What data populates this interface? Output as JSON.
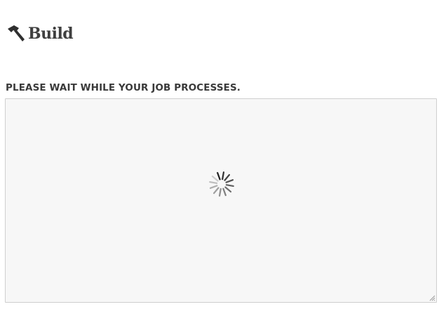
{
  "header": {
    "brand_icon": "hammer-icon",
    "title": "Build"
  },
  "main": {
    "status_heading": "PLEASE WAIT WHILE YOUR JOB PROCESSES.",
    "output_panel": {
      "state": "loading",
      "spinner_icon": "loading-spinner-icon",
      "resize_icon": "resize-grip-icon"
    }
  },
  "colors": {
    "text": "#3a3a3a",
    "panel_background": "#f7f7f7",
    "panel_border": "#cfcfcf",
    "spinner_dark": "#222222",
    "spinner_light": "#cccccc"
  }
}
